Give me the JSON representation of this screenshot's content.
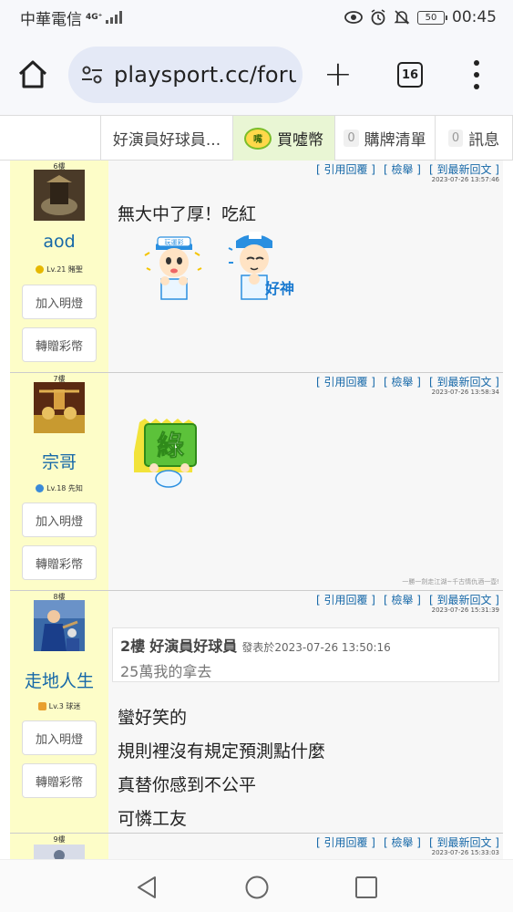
{
  "status_bar": {
    "carrier": "中華電信",
    "network": "4G⁺",
    "battery": "50",
    "time": "00:45"
  },
  "browser": {
    "url": "playsport.cc/foru",
    "tab_count": "16"
  },
  "site_nav": {
    "forum_title": "好演員好球員...",
    "coin_icon_text": "嘴",
    "buy_coins": "買噓幣",
    "buy_list_count": "0",
    "buy_list": "購牌清單",
    "messages_count": "0",
    "messages": "訊息"
  },
  "post_actions": {
    "quote_reply": "[ 引用回覆 ]",
    "report": "[ 檢舉 ]",
    "to_latest": "[ 到最新回文 ]"
  },
  "sidebar_buttons": {
    "light": "加入明燈",
    "gift": "轉贈彩幣"
  },
  "posts": [
    {
      "floor": "6樓",
      "username": "aod",
      "level": "Lv.21 賭聖",
      "time": "2023-07-26 13:57:46",
      "lines": [
        "無大中了厚！吃紅"
      ],
      "sticker_texts": [
        "玩運彩",
        "好神"
      ]
    },
    {
      "floor": "7樓",
      "username": "宗哥",
      "level": "Lv.18 先知",
      "time": "2023-07-26 13:58:34",
      "lines": [],
      "sticker_texts": [
        "綠"
      ],
      "signature": "一勝一劍走江湖~千古情仇酒一壺!"
    },
    {
      "floor": "8樓",
      "username": "走地人生",
      "level": "Lv.3 球迷",
      "time": "2023-07-26 15:31:39",
      "quote": {
        "floor": "2樓",
        "author": "好演員好球員",
        "posted_label": "發表於2023-07-26 13:50:16",
        "text": "25萬我的拿去"
      },
      "lines": [
        "蠻好笑的",
        "規則裡沒有規定預測點什麼",
        "真替你感到不公平",
        "可憐工友"
      ]
    },
    {
      "floor": "9樓",
      "time": "2023-07-26 15:33:03"
    }
  ]
}
